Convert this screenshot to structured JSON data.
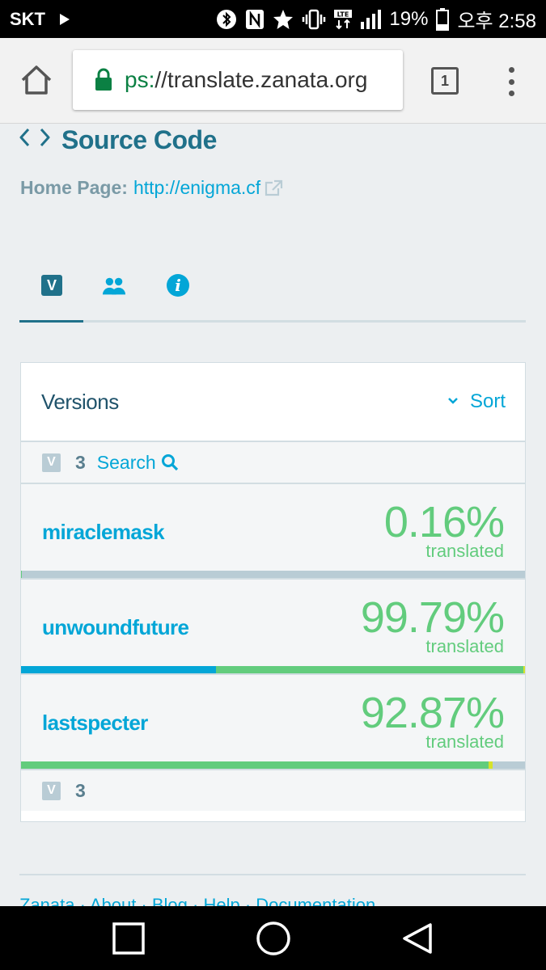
{
  "status_bar": {
    "carrier": "SKT",
    "battery": "19%",
    "time": "오후 2:58",
    "icons": [
      "play-icon",
      "bluetooth-icon",
      "nfc-icon",
      "star-icon",
      "vibrate-icon",
      "lte-icon",
      "signal-icon",
      "battery-icon"
    ]
  },
  "browser": {
    "url_scheme": "ps:",
    "url_rest": "//translate.zanata.org",
    "tab_count": "1"
  },
  "page": {
    "title": "Source Code",
    "home_page_label": "Home Page:",
    "home_page_url": "http://enigma.cf",
    "tabs": [
      "versions-tab",
      "people-tab",
      "info-tab"
    ],
    "versions_tab_letter": "V",
    "panel": {
      "title": "Versions",
      "sort_label": "Sort",
      "count": "3",
      "search_label": "Search",
      "footer_count": "3",
      "versions": [
        {
          "name": "miraclemask",
          "percent": "0.16%",
          "label": "translated",
          "bar": {
            "approved": 0,
            "translated": 0.16,
            "fuzzy": 0
          }
        },
        {
          "name": "unwoundfuture",
          "percent": "99.79%",
          "label": "translated",
          "bar": {
            "approved": 38.7,
            "translated": 61.0,
            "fuzzy": 0.3
          }
        },
        {
          "name": "lastspecter",
          "percent": "92.87%",
          "label": "translated",
          "bar": {
            "approved": 0,
            "translated": 92.8,
            "fuzzy": 0.8
          }
        }
      ]
    },
    "footer_text": "Zanata · About · Blog · Help · Documentation"
  },
  "colors": {
    "accent": "#03a6d7",
    "dark_accent": "#20718a",
    "translated": "#62cc7d",
    "untranslated": "#b9ccd5",
    "fuzzy": "#d6e32a",
    "page_bg": "#eceff1"
  }
}
